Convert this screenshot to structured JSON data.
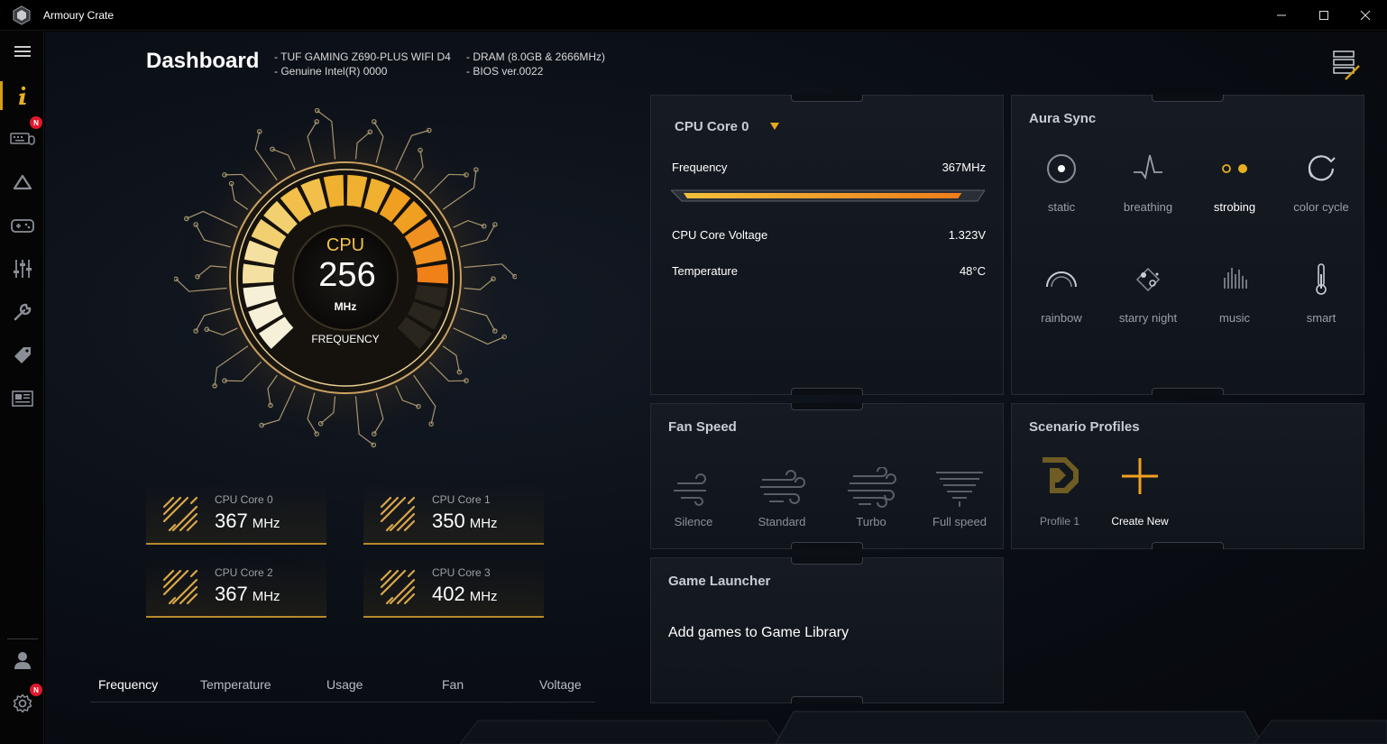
{
  "window": {
    "title": "Armoury Crate",
    "controls": [
      "minimize",
      "maximize",
      "close"
    ]
  },
  "sidebar": {
    "items": [
      {
        "name": "menu-icon"
      },
      {
        "name": "info-icon",
        "active": true
      },
      {
        "name": "devices-icon",
        "badge": "N"
      },
      {
        "name": "aura-icon"
      },
      {
        "name": "game-library-icon"
      },
      {
        "name": "settings-tuning-icon"
      },
      {
        "name": "tools-icon"
      },
      {
        "name": "deals-icon"
      },
      {
        "name": "news-icon"
      }
    ],
    "bottom": [
      {
        "name": "user-icon"
      },
      {
        "name": "settings-icon",
        "badge": "N"
      }
    ]
  },
  "header": {
    "title": "Dashboard",
    "sys_left": [
      "-  TUF GAMING Z690-PLUS WIFI D4",
      "-  Genuine Intel(R) 0000"
    ],
    "sys_right": [
      "-  DRAM (8.0GB & 2666MHz)",
      "-  BIOS ver.0022"
    ]
  },
  "gauge": {
    "label": "CPU",
    "value": "256",
    "unit": "MHz",
    "caption": "FREQUENCY",
    "level": 0.85
  },
  "cores": [
    {
      "name": "CPU Core 0",
      "value": "367",
      "unit": "MHz"
    },
    {
      "name": "CPU Core 1",
      "value": "350",
      "unit": "MHz"
    },
    {
      "name": "CPU Core 2",
      "value": "367",
      "unit": "MHz"
    },
    {
      "name": "CPU Core 3",
      "value": "402",
      "unit": "MHz"
    }
  ],
  "tabs": [
    "Frequency",
    "Temperature",
    "Usage",
    "Fan",
    "Voltage"
  ],
  "cpu_panel": {
    "selector": "CPU Core 0",
    "frequency_label": "Frequency",
    "frequency_value": "367MHz",
    "frequency_level": 0.97,
    "voltage_label": "CPU Core Voltage",
    "voltage_value": "1.323V",
    "temp_label": "Temperature",
    "temp_value": "48°C"
  },
  "aura": {
    "title": "Aura Sync",
    "effects": [
      "static",
      "breathing",
      "strobing",
      "color cycle",
      "rainbow",
      "starry night",
      "music",
      "smart"
    ],
    "active": "strobing"
  },
  "fan": {
    "title": "Fan Speed",
    "modes": [
      "Silence",
      "Standard",
      "Turbo",
      "Full speed"
    ]
  },
  "profiles": {
    "title": "Scenario Profiles",
    "items": [
      "Profile 1",
      "Create New"
    ]
  },
  "game_launcher": {
    "title": "Game Launcher",
    "message": "Add games to Game Library"
  },
  "colors": {
    "accent": "#d4a017",
    "orange": "#f07c1a",
    "badge": "#e0182c"
  }
}
